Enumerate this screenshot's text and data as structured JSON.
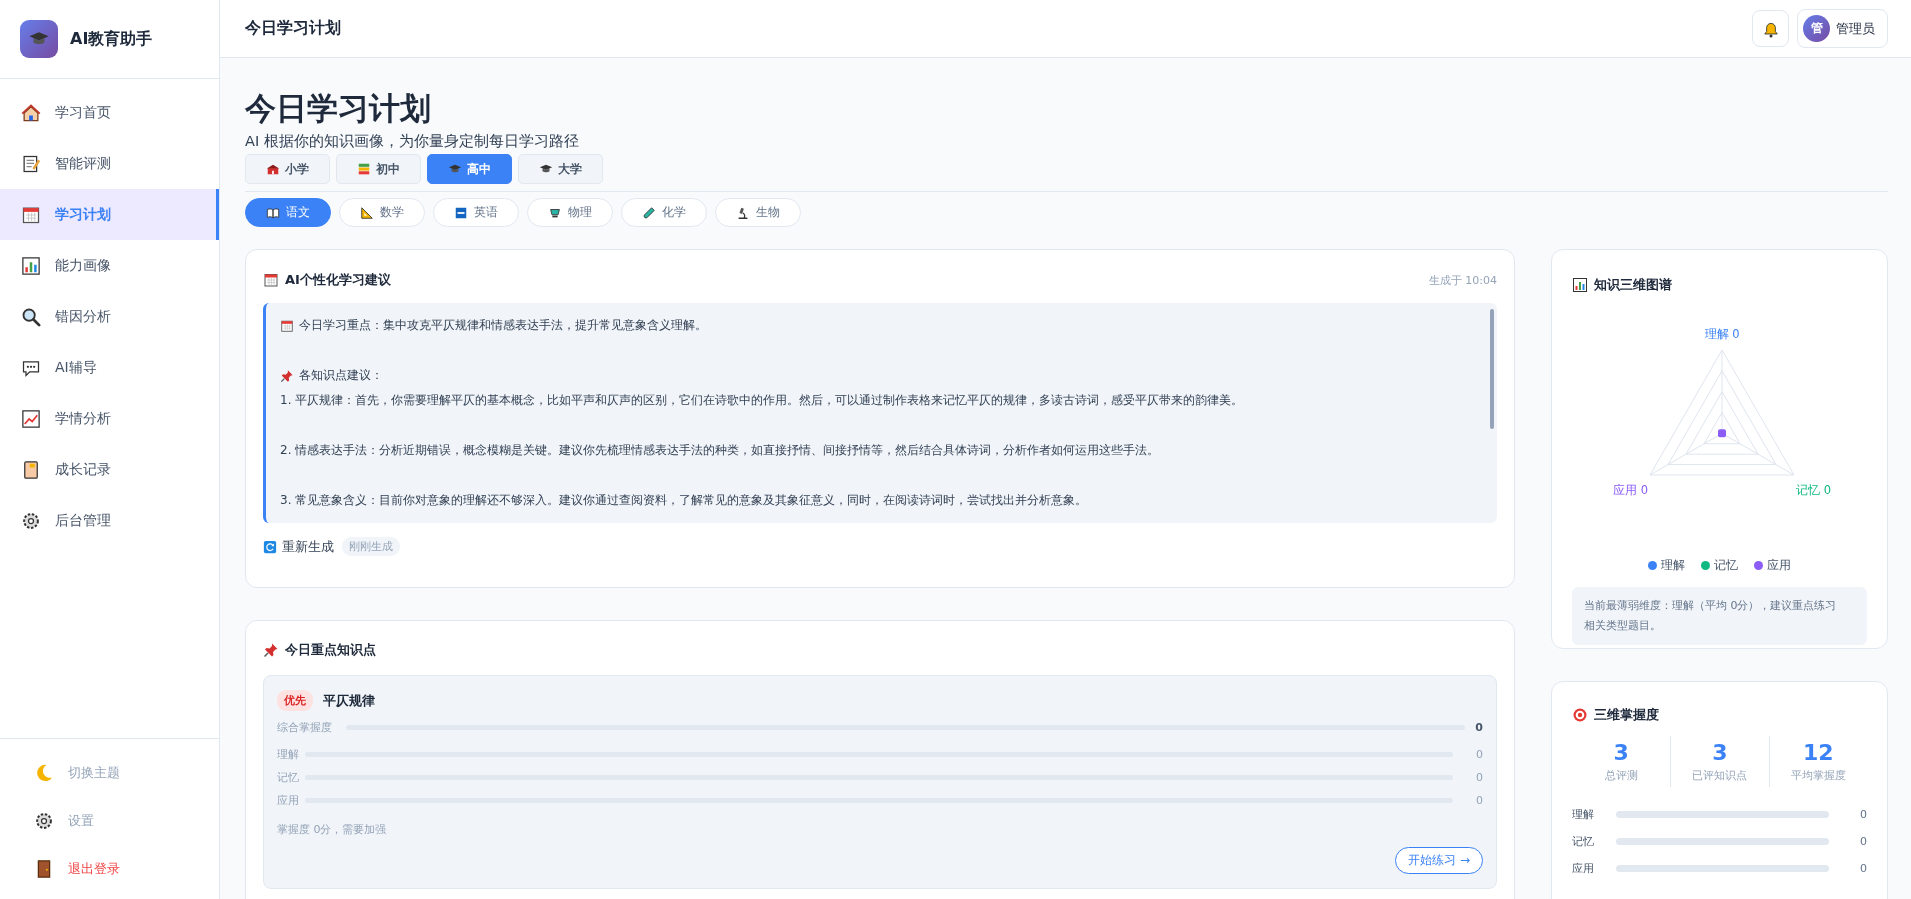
{
  "app": {
    "name": "AI教育助手"
  },
  "sidebar": {
    "items": [
      {
        "label": "学习首页",
        "selected": false
      },
      {
        "label": "智能评测",
        "selected": false
      },
      {
        "label": "学习计划",
        "selected": true
      },
      {
        "label": "能力画像",
        "selected": false
      },
      {
        "label": "错因分析",
        "selected": false
      },
      {
        "label": "AI辅导",
        "selected": false
      },
      {
        "label": "学情分析",
        "selected": false
      },
      {
        "label": "成长记录",
        "selected": false
      },
      {
        "label": "后台管理",
        "selected": false
      }
    ],
    "footer": [
      {
        "label": "切换主题",
        "kind": "normal"
      },
      {
        "label": "设置",
        "kind": "normal"
      },
      {
        "label": "退出登录",
        "kind": "danger"
      }
    ]
  },
  "header": {
    "title": "今日学习计划",
    "user": {
      "avatar": "管",
      "name": "管理员"
    }
  },
  "page": {
    "title": "今日学习计划",
    "subtitle": "AI 根据你的知识画像，为你量身定制每日学习路径"
  },
  "levels": [
    {
      "label": "小学",
      "selected": false
    },
    {
      "label": "初中",
      "selected": false
    },
    {
      "label": "高中",
      "selected": true
    },
    {
      "label": "大学",
      "selected": false
    }
  ],
  "subjects": [
    {
      "label": "语文",
      "selected": true
    },
    {
      "label": "数学",
      "selected": false
    },
    {
      "label": "英语",
      "selected": false
    },
    {
      "label": "物理",
      "selected": false
    },
    {
      "label": "化学",
      "selected": false
    },
    {
      "label": "生物",
      "selected": false
    }
  ],
  "suggestion": {
    "title": "AI个性化学习建议",
    "time": "生成于 10:04",
    "focus": "今日学习重点：集中攻克平仄规律和情感表达手法，提升常见意象含义理解。",
    "points_title": "各知识点建议：",
    "points": [
      "1. 平仄规律：首先，你需要理解平仄的基本概念，比如平声和仄声的区别，它们在诗歌中的作用。然后，可以通过制作表格来记忆平仄的规律，多读古诗词，感受平仄带来的韵律美。",
      "2. 情感表达手法：分析近期错误，概念模糊是关键。建议你先梳理情感表达手法的种类，如直接抒情、间接抒情等，然后结合具体诗词，分析作者如何运用这些手法。",
      "3. 常见意象含义：目前你对意象的理解还不够深入。建议你通过查阅资料，了解常见的意象及其象征意义，同时，在阅读诗词时，尝试找出并分析意象。"
    ],
    "regenerate": "重新生成",
    "badge": "刚刚生成"
  },
  "key_points": {
    "title": "今日重点知识点",
    "items": [
      {
        "tag": "优先",
        "name": "平仄规律",
        "overall": {
          "label": "综合掌握度",
          "level": 0,
          "value": "0"
        },
        "dims": [
          {
            "label": "理解",
            "level": 0,
            "value": "0"
          },
          {
            "label": "记忆",
            "level": 0,
            "value": "0"
          },
          {
            "label": "应用",
            "level": 0,
            "value": "0"
          }
        ],
        "note": "掌握度 0分，需要加强",
        "action": "开始练习 →"
      }
    ]
  },
  "radar": {
    "title": "知识三维图谱",
    "axes": [
      {
        "label": "理解 0",
        "color": "#3b82f6"
      },
      {
        "label": "记忆 0",
        "color": "#10b981"
      },
      {
        "label": "应用 0",
        "color": "#8b5cf6"
      }
    ],
    "legend": [
      {
        "label": "理解",
        "color": "#3b82f6"
      },
      {
        "label": "记忆",
        "color": "#10b981"
      },
      {
        "label": "应用",
        "color": "#8b5cf6"
      }
    ],
    "tip": "当前最薄弱维度：理解（平均 0分），建议重点练习相关类型题目。"
  },
  "mastery": {
    "title": "三维掌握度",
    "stats": [
      {
        "value": "3",
        "label": "总评测"
      },
      {
        "value": "3",
        "label": "已评知识点"
      },
      {
        "value": "12",
        "label": "平均掌握度"
      }
    ],
    "bars": [
      {
        "label": "理解",
        "level": 0,
        "value": "0"
      },
      {
        "label": "记忆",
        "level": 0,
        "value": "0"
      },
      {
        "label": "应用",
        "level": 0,
        "value": "0"
      }
    ]
  }
}
